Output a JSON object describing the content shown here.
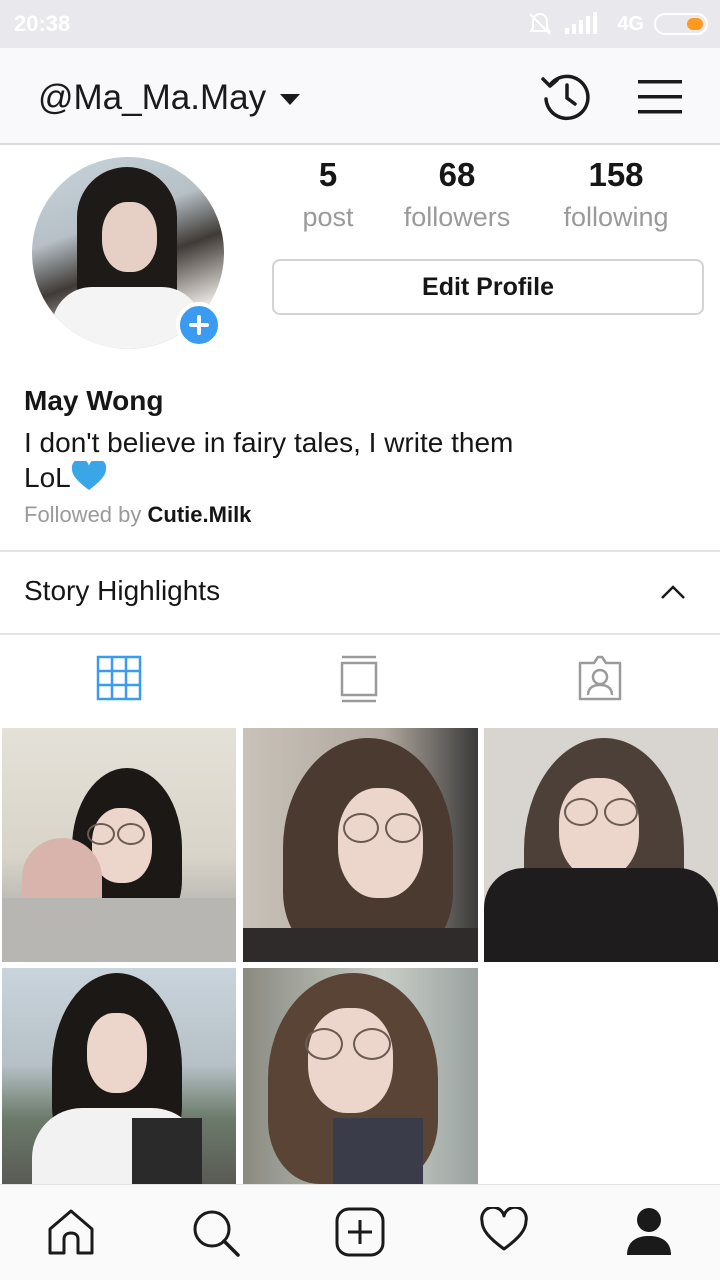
{
  "status_bar": {
    "time": "20:38",
    "network": "4G"
  },
  "header": {
    "username": "@Ma_Ma.May"
  },
  "profile": {
    "stats": [
      {
        "value": "5",
        "label": "post"
      },
      {
        "value": "68",
        "label": "followers"
      },
      {
        "value": "158",
        "label": "following"
      }
    ],
    "edit_button": "Edit Profile",
    "full_name": "May Wong",
    "bio_line1": "I don't believe in fairy tales, I write them",
    "bio_line2": "LoL",
    "followed_by_prefix": "Followed by ",
    "followed_by_user": "Cutie.Milk"
  },
  "highlights": {
    "title": "Story Highlights"
  },
  "tabs": [
    "grid-icon",
    "feed-icon",
    "tagged-icon"
  ],
  "colors": {
    "accent": "#3b9bf0",
    "heart": "#3aa6e8",
    "battery": "#ff9a1f"
  },
  "grid_photos": 5
}
